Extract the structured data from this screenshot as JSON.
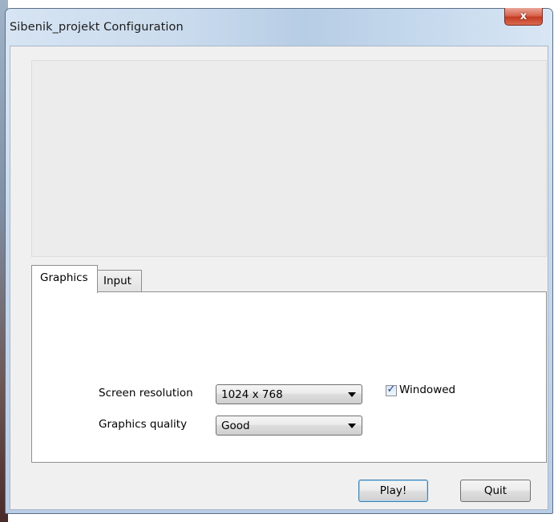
{
  "window": {
    "title": "Sibenik_projekt Configuration",
    "close_glyph": "x"
  },
  "tabs": [
    {
      "label": "Graphics",
      "selected": true
    },
    {
      "label": "Input",
      "selected": false
    }
  ],
  "graphics": {
    "resolution_label": "Screen resolution",
    "resolution_value": "1024 x 768",
    "quality_label": "Graphics quality",
    "quality_value": "Good",
    "windowed_label": "Windowed",
    "windowed_checked": true,
    "check_glyph": "✓"
  },
  "buttons": {
    "play": "Play!",
    "quit": "Quit"
  },
  "icons": {
    "close": "close-icon",
    "dropdown": "chevron-down-icon",
    "checkmark": "checkmark-icon"
  },
  "colors": {
    "titlebar": "#cbdcee",
    "close_button": "#c9432c",
    "client_background": "#f0f0f0",
    "panel_background": "#ffffff",
    "default_button_border": "#3c7fb1"
  }
}
